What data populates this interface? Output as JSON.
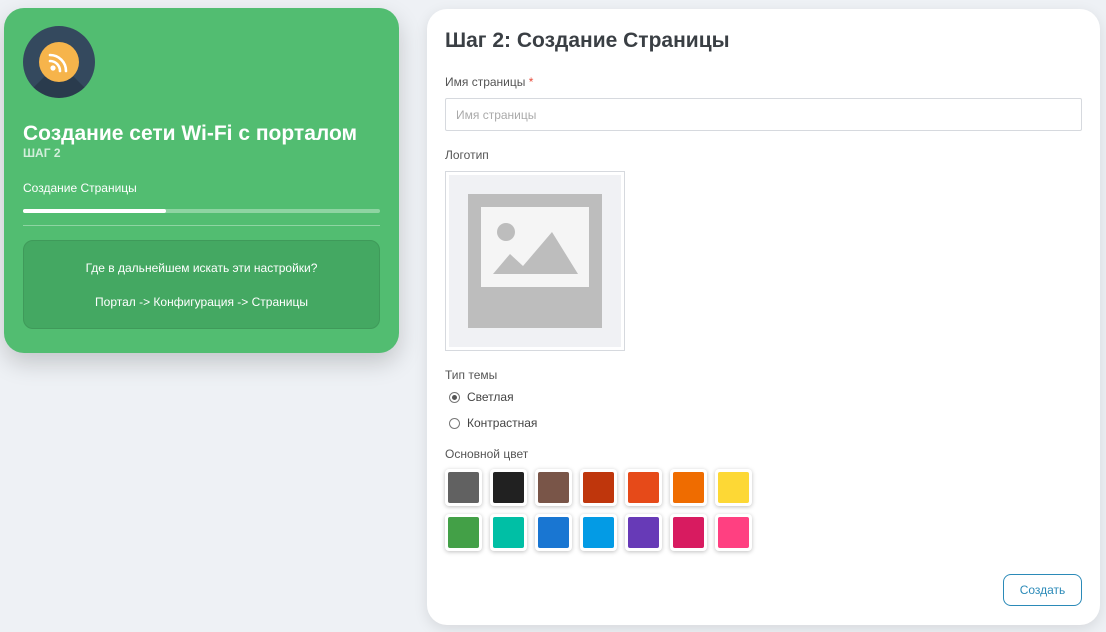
{
  "sidebar": {
    "title": "Создание сети Wi-Fi с порталом",
    "step_label": "ШАГ 2",
    "current_step": "Создание Страницы",
    "progress_fraction": 0.4,
    "hint": {
      "question": "Где в дальнейшем искать эти настройки?",
      "path": "Портал -> Конфигурация -> Страницы"
    },
    "logo_icon": "rss-wifi-icon"
  },
  "form": {
    "title": "Шаг 2: Создание Страницы",
    "page_name": {
      "label": "Имя страницы",
      "required_mark": "*",
      "placeholder": "Имя страницы",
      "value": ""
    },
    "logo": {
      "label": "Логотип",
      "icon": "image-placeholder-icon"
    },
    "theme": {
      "label": "Тип темы",
      "options": [
        {
          "label": "Светлая",
          "selected": true
        },
        {
          "label": "Контрастная",
          "selected": false
        }
      ]
    },
    "primary_color": {
      "label": "Основной цвет",
      "colors": [
        "#616161",
        "#212121",
        "#795548",
        "#bf360c",
        "#e64a19",
        "#ef6c00",
        "#fdd835",
        "#43a047",
        "#00bfa5",
        "#1976d2",
        "#039be5",
        "#673ab7",
        "#d81b60",
        "#ff4081"
      ]
    },
    "submit_label": "Создать"
  }
}
